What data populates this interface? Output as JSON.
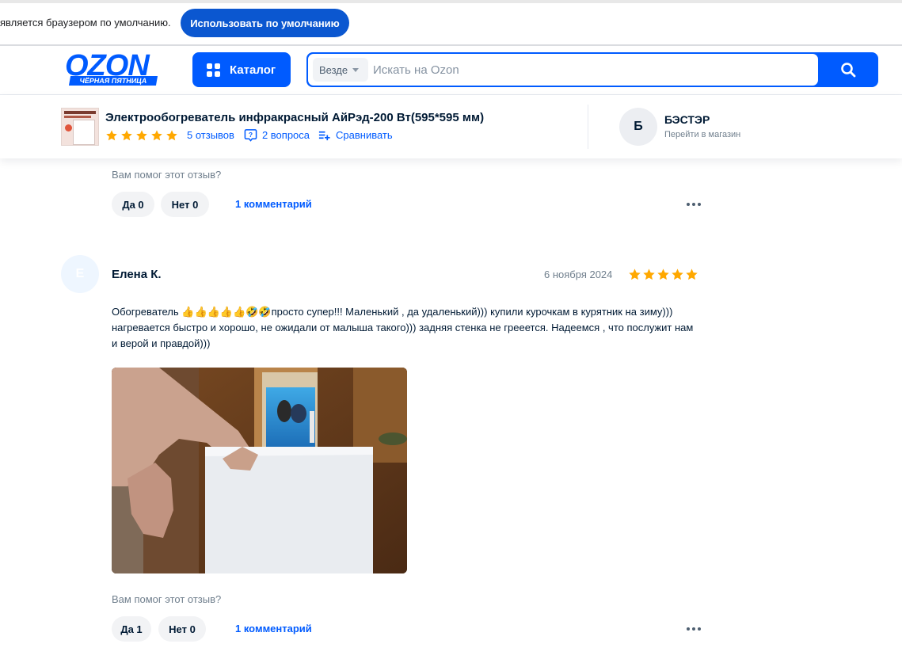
{
  "default_browser_bar": {
    "message": "является браузером по умолчанию.",
    "button_label": "Использовать по умолчанию"
  },
  "header": {
    "logo_text": "OZON",
    "logo_tagline": "ЧЁРНАЯ ПЯТНИЦА",
    "catalog_label": "Каталог",
    "search_scope": "Везде",
    "search_placeholder": "Искать на Ozon",
    "accent_color": "#005bff"
  },
  "product_bar": {
    "title": "Электрообогреватель инфракрасный АйРэд-200 Вт(595*595 мм)",
    "rating": 5,
    "reviews_link": "5 отзывов",
    "questions_link": "2 вопроса",
    "compare_link": "Сравнивать",
    "shop_initial": "Б",
    "shop_name": "БЭСТЭР",
    "shop_link": "Перейти в магазин",
    "star_color": "#ffa800"
  },
  "previous_review": {
    "helpful_question": "Вам помог этот отзыв?",
    "yes_label": "Да 0",
    "no_label": "Нет 0",
    "comments_link": "1 комментарий"
  },
  "review": {
    "avatar_initial": "Е",
    "author": "Елена К.",
    "date": "6 ноября 2024",
    "rating": 5,
    "text": "Обогреватель 👍👍👍👍👍🤣🤣просто супер!!! Маленький , да удаленький))) купили курочкам в курятник на зиму))) нагревается быстро и хорошо, не ожидали от малыша такого))) задняя стенка не греeется. Надеемся , что послужит нам и верой и правдой)))",
    "helpful_question": "Вам помог этот отзыв?",
    "yes_label": "Да 1",
    "no_label": "Нет 0",
    "comments_link": "1 комментарий"
  }
}
